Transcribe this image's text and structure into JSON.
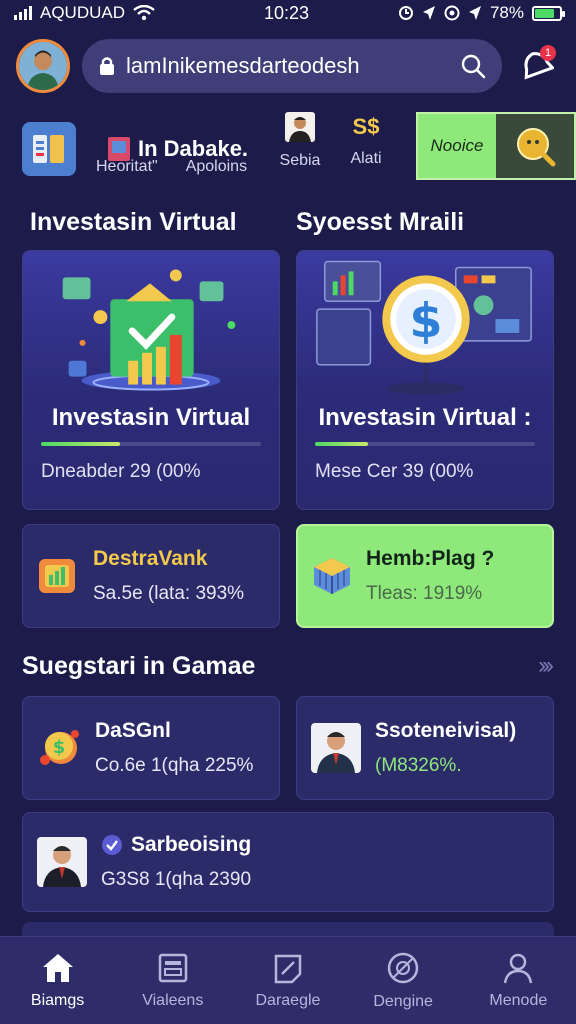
{
  "status_bar": {
    "carrier": "AQUDUAD",
    "time": "10:23",
    "battery": "78%",
    "battery_level": 0.78
  },
  "header": {
    "search_value": "lamInikemesdarteodesh",
    "notification_count": "1"
  },
  "quick_row": {
    "title": "In Dabake.",
    "items": [
      {
        "label": "Heoritat\""
      },
      {
        "label": "Apoloins"
      },
      {
        "label": "Sebia"
      },
      {
        "value": "S$",
        "label": "Alati"
      }
    ],
    "green_label": "Nooice"
  },
  "sections": {
    "left_heading": "Investasin Virtual",
    "right_heading": "Syoesst Mraili",
    "games_heading": "Suegstari in Gamae"
  },
  "feature_cards": [
    {
      "title": "Investasin Virtual",
      "meta": "Dneabder 29 (00%",
      "progress": 0.36
    },
    {
      "title": "Investasin Virtual :",
      "meta": "Mese Cer 39 (00%",
      "progress": 0.24
    }
  ],
  "mini_cards": [
    {
      "title": "DestraVank",
      "sub": "Sa.5e (lata: 393%",
      "accent": "#f2c94c"
    },
    {
      "title": "Hemb:Plag ?",
      "sub": "Tleas: 1919%"
    }
  ],
  "game_cards": [
    {
      "title": "DaSGnl",
      "sub": "Co.6e 1(qha 225%"
    },
    {
      "title": "Ssoteneivisal)",
      "sub": "(M8326%."
    },
    {
      "title": "Sarbeoising",
      "sub": "G3S8 1(qha 2390"
    }
  ],
  "bottom_nav": [
    {
      "label": "Biamgs",
      "icon": "home-icon"
    },
    {
      "label": "Vialeens",
      "icon": "calendar-icon"
    },
    {
      "label": "Daraegle",
      "icon": "document-icon"
    },
    {
      "label": "Dengine",
      "icon": "globe-icon"
    },
    {
      "label": "Menode",
      "icon": "user-icon"
    }
  ],
  "colors": {
    "background": "#1c1b4a",
    "card": "#2c2b6a",
    "accent_green": "#8ee87a",
    "avatar_ring": "#f08a3c"
  }
}
